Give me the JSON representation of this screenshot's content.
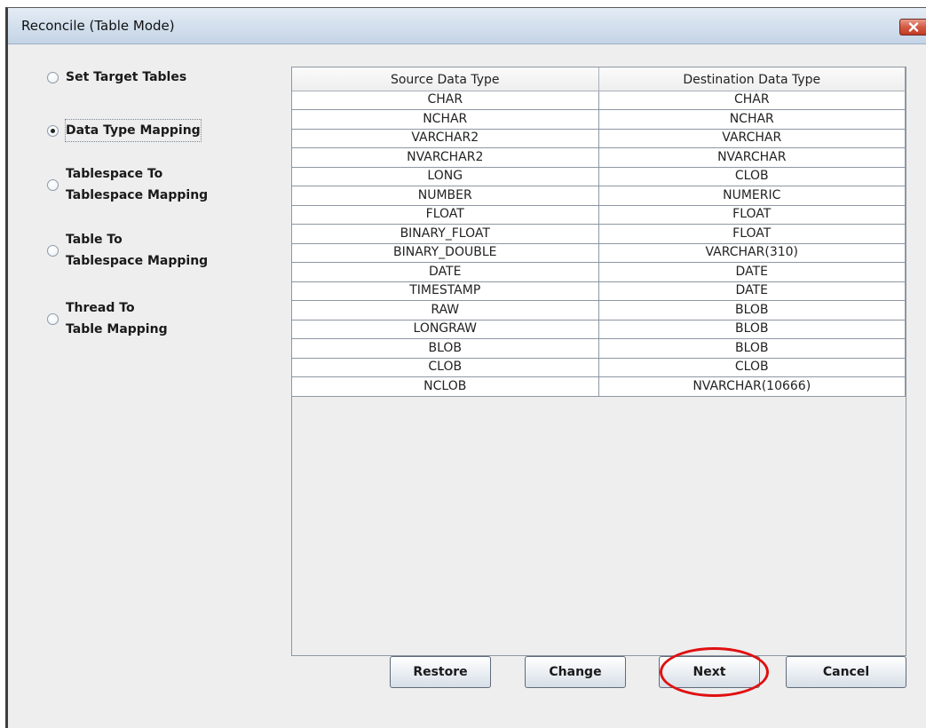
{
  "window": {
    "title": "Reconcile (Table Mode)",
    "close_icon": "close-icon"
  },
  "steps": [
    {
      "line1": "Set Target Tables",
      "line2": "",
      "selected": false
    },
    {
      "line1": "Data Type Mapping",
      "line2": "",
      "selected": true
    },
    {
      "line1": "Tablespace To",
      "line2": "Tablespace Mapping",
      "selected": false
    },
    {
      "line1": "Table To",
      "line2": "Tablespace Mapping",
      "selected": false
    },
    {
      "line1": "Thread To",
      "line2": "Table Mapping",
      "selected": false
    }
  ],
  "table": {
    "columns": [
      "Source Data Type",
      "Destination Data Type"
    ],
    "rows": [
      [
        "CHAR",
        "CHAR"
      ],
      [
        "NCHAR",
        "NCHAR"
      ],
      [
        "VARCHAR2",
        "VARCHAR"
      ],
      [
        "NVARCHAR2",
        "NVARCHAR"
      ],
      [
        "LONG",
        "CLOB"
      ],
      [
        "NUMBER",
        "NUMERIC"
      ],
      [
        "FLOAT",
        "FLOAT"
      ],
      [
        "BINARY_FLOAT",
        "FLOAT"
      ],
      [
        "BINARY_DOUBLE",
        "VARCHAR(310)"
      ],
      [
        "DATE",
        "DATE"
      ],
      [
        "TIMESTAMP",
        "DATE"
      ],
      [
        "RAW",
        "BLOB"
      ],
      [
        "LONGRAW",
        "BLOB"
      ],
      [
        "BLOB",
        "BLOB"
      ],
      [
        "CLOB",
        "CLOB"
      ],
      [
        "NCLOB",
        "NVARCHAR(10666)"
      ]
    ]
  },
  "buttons": {
    "restore": "Restore",
    "change": "Change",
    "next": "Next",
    "cancel": "Cancel"
  },
  "colors": {
    "highlight": "#e01010",
    "titlebar": "#d5e1ee",
    "close": "#d45a44"
  }
}
